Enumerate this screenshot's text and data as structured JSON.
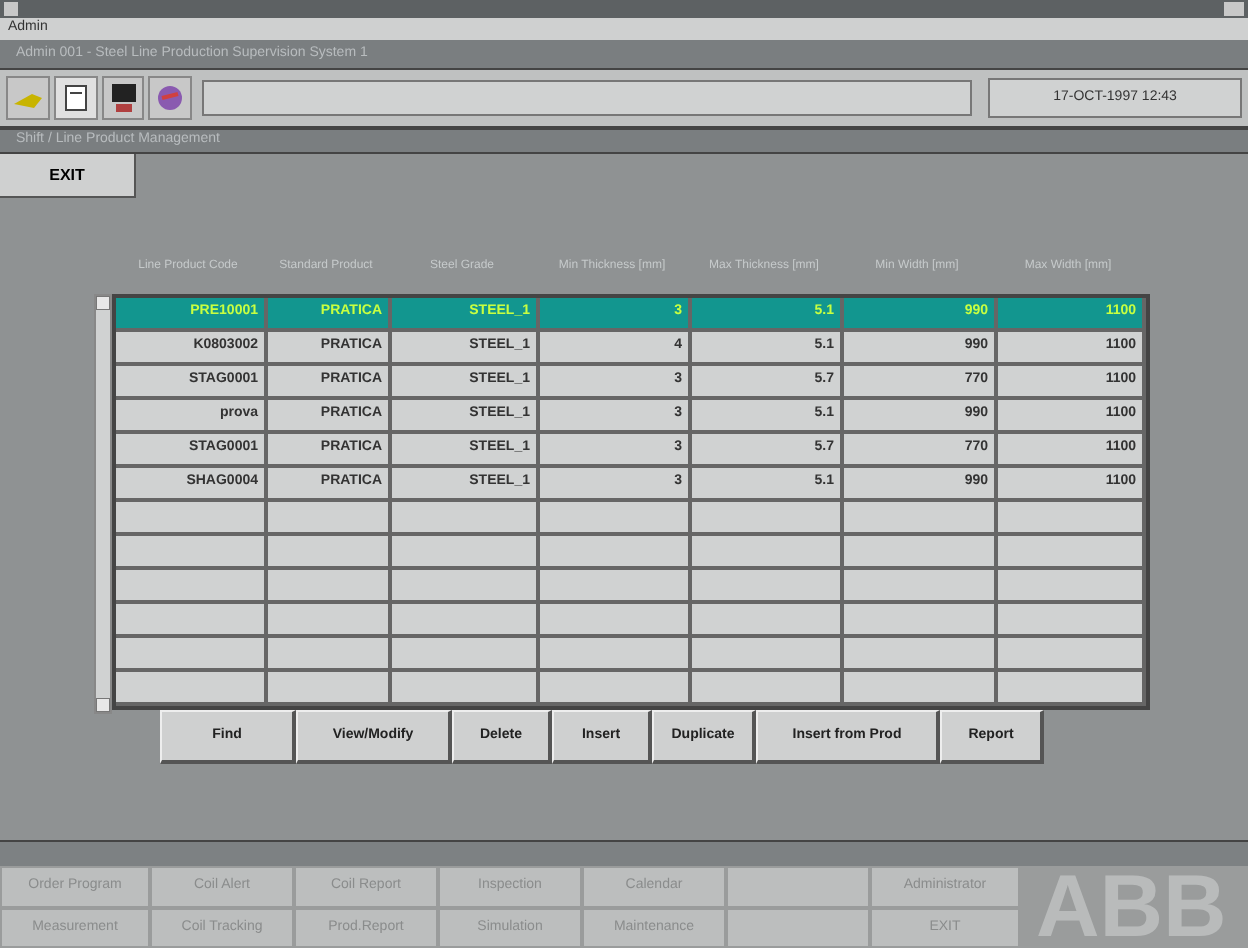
{
  "menu": [
    "Admin"
  ],
  "window_title": "Admin 001 - Steel Line Production Supervision System 1",
  "date": "17-OCT-1997 12:43",
  "panel_title": "Shift / Line Product Management",
  "exit_button": "EXIT",
  "table": {
    "columns": [
      "Line Product Code",
      "Standard Product",
      "Steel Grade",
      "Min Thickness [mm]",
      "Max Thickness [mm]",
      "Min Width [mm]",
      "Max Width [mm]"
    ],
    "rows": [
      {
        "selected": true,
        "cells": [
          "PRE10001",
          "PRATICA",
          "STEEL_1",
          "3",
          "5.1",
          "990",
          "1100"
        ]
      },
      {
        "selected": false,
        "cells": [
          "K0803002",
          "PRATICA",
          "STEEL_1",
          "4",
          "5.1",
          "990",
          "1100"
        ]
      },
      {
        "selected": false,
        "cells": [
          "STAG0001",
          "PRATICA",
          "STEEL_1",
          "3",
          "5.7",
          "770",
          "1100"
        ]
      },
      {
        "selected": false,
        "cells": [
          "prova",
          "PRATICA",
          "STEEL_1",
          "3",
          "5.1",
          "990",
          "1100"
        ]
      },
      {
        "selected": false,
        "cells": [
          "STAG0001",
          "PRATICA",
          "STEEL_1",
          "3",
          "5.7",
          "770",
          "1100"
        ]
      },
      {
        "selected": false,
        "cells": [
          "SHAG0004",
          "PRATICA",
          "STEEL_1",
          "3",
          "5.1",
          "990",
          "1100"
        ]
      }
    ]
  },
  "actions": [
    "Find",
    "View/Modify",
    "Delete",
    "Insert",
    "Duplicate",
    "Insert from Prod",
    "Report"
  ],
  "nav": [
    {
      "items": [
        "Order Program",
        "Coil Alert",
        "Coil Report",
        "Inspection",
        "Calendar"
      ],
      "end": "Administrator"
    },
    {
      "items": [
        "Measurement",
        "Coil Tracking",
        "Prod.Report",
        "Simulation",
        "Maintenance"
      ],
      "end": "EXIT"
    }
  ],
  "logo": "ABB"
}
